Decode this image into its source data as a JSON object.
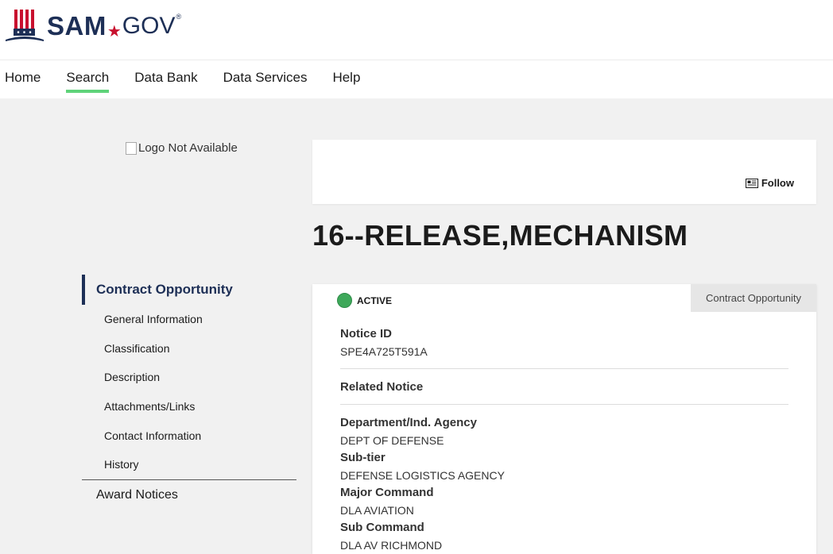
{
  "brand": {
    "name": "SAM",
    "domain": "GOV",
    "mark": "®",
    "accent": "#c8102e",
    "navy": "#1d2f56"
  },
  "nav": {
    "items": [
      "Home",
      "Search",
      "Data Bank",
      "Data Services",
      "Help"
    ],
    "active": "Search"
  },
  "side_logo_alt": "Logo Not Available",
  "sidenav": {
    "group_title": "Contract Opportunity",
    "subitems": [
      "General Information",
      "Classification",
      "Description",
      "Attachments/Links",
      "Contact Information",
      "History"
    ],
    "other": "Award Notices"
  },
  "follow_label": "Follow",
  "page_title": "16--RELEASE,MECHANISM",
  "notice": {
    "status": "ACTIVE",
    "type_tag": "Contract Opportunity",
    "notice_id_label": "Notice ID",
    "notice_id": "SPE4A725T591A",
    "related_label": "Related Notice",
    "dept_label": "Department/Ind. Agency",
    "dept": "DEPT OF DEFENSE",
    "subtier_label": "Sub-tier",
    "subtier": "DEFENSE LOGISTICS AGENCY",
    "major_label": "Major Command",
    "major": "DLA AVIATION",
    "subcmd_label": "Sub Command",
    "subcmd": "DLA AV RICHMOND"
  }
}
